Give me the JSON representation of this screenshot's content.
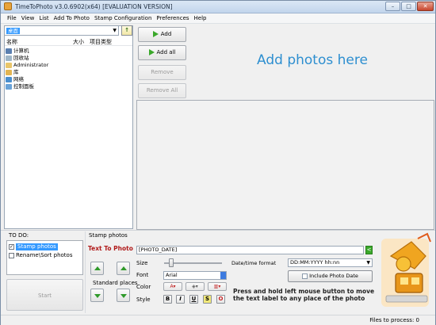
{
  "window": {
    "title": "TimeToPhoto v3.0.6902(x64) [EVALUATION VERSION]",
    "controls": [
      "–",
      "□",
      "✕"
    ]
  },
  "menu": [
    "File",
    "View",
    "List",
    "Add To Photo",
    "Stamp Configuration",
    "Preferences",
    "Help"
  ],
  "explorer": {
    "location": "桌面",
    "columns": {
      "name": "名称",
      "size": "大小",
      "type": "项目类型"
    },
    "items": [
      {
        "label": "计算机",
        "icon": "computer-icon"
      },
      {
        "label": "回收站",
        "icon": "recycle-bin-icon"
      },
      {
        "label": "Administrator",
        "icon": "user-folder-icon"
      },
      {
        "label": "库",
        "icon": "library-icon"
      },
      {
        "label": "网络",
        "icon": "network-icon"
      },
      {
        "label": "控制面板",
        "icon": "control-panel-icon"
      }
    ]
  },
  "actions": {
    "add": "Add",
    "add_all": "Add all",
    "remove": "Remove",
    "remove_all": "Remove All"
  },
  "dropzone": {
    "hint": "Add photos here"
  },
  "todo": {
    "label": "TO DO:",
    "items": [
      {
        "label": "Stamp photos",
        "checked": true,
        "selected": true
      },
      {
        "label": "Rename\\Sort photos",
        "checked": false,
        "selected": false
      }
    ],
    "start": "Start"
  },
  "stamp": {
    "section_label": "Stamp photos",
    "text_to_photo_label": "Text To Photo",
    "text_value": "[PHOTO_DATE]",
    "standard_places": "Standard places",
    "size_label": "Size",
    "font_label": "Font",
    "font_value": "Arial",
    "color_label": "Color",
    "style_label": "Style",
    "style_buttons": [
      "B",
      "I",
      "U",
      "S",
      "O"
    ],
    "datetime_label": "Date/time format",
    "datetime_value": "DD:MM:YYYY hh:nn",
    "include_date": "Include Photo Date",
    "hint": "Press and hold left mouse button to move the text label to any place of the photo"
  },
  "status": {
    "files_to_process": "Files to process: 0"
  },
  "colors": {
    "accent": "#2e8fd0",
    "label_red": "#b01a1a",
    "green": "#3aa82a",
    "selection": "#3399ff"
  }
}
